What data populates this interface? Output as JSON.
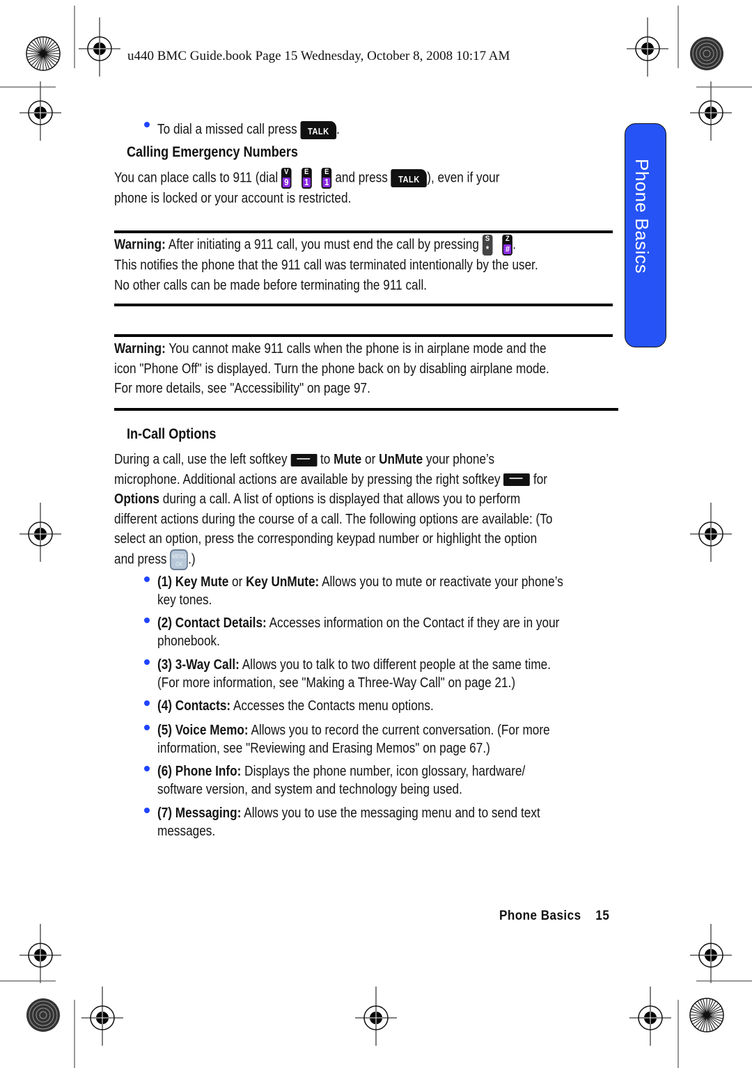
{
  "header": {
    "print_line": "u440 BMC Guide.book  Page 15  Wednesday, October 8, 2008  10:17 AM"
  },
  "side_tab": {
    "label": "Phone Basics",
    "color": "#2653f5"
  },
  "intro_bullet": {
    "text": "To dial a missed call press",
    "key_icon": "talk-key-icon",
    "key_label": "TALK",
    "suffix": "."
  },
  "emergency": {
    "heading": "Calling Emergency Numbers",
    "line1_a": "You can place calls to 911 (dial",
    "keys": [
      {
        "top": "V",
        "bottom": "9"
      },
      {
        "top": "E",
        "bottom": "1"
      },
      {
        "top": "E",
        "bottom": "1"
      }
    ],
    "line1_b": "and press",
    "talk_label": "TALK",
    "line1_c": "), even if your",
    "line2": "phone is locked or your account is restricted."
  },
  "warning1": {
    "label": "Warning:",
    "line1": "After initiating a 911 call, you must end the call by pressing",
    "keys": [
      {
        "top": "S",
        "bottom": "*"
      },
      {
        "top": "Z",
        "bottom": "#"
      }
    ],
    "line1_end": ".",
    "line2": "This notifies the phone that the 911 call was terminated intentionally by the user.",
    "line3": "No other calls can be made before terminating the 911 call."
  },
  "warning2": {
    "label": "Warning:",
    "line1": "You cannot make 911 calls when the phone is in airplane mode and the",
    "line2": "icon \"Phone Off\" is displayed. Turn the phone back on by disabling airplane mode.",
    "line3": "For more details, see \"Accessibility\" on page 97."
  },
  "in_call": {
    "heading": "In-Call Options",
    "p1_a": "During a call, use the left softkey",
    "p1_b": "to",
    "p1_mute": "Mute",
    "p1_or": "or",
    "p1_unmute": "UnMute",
    "p1_c": "your phone’s",
    "p2_a": "microphone. Additional actions are available by pressing the right softkey",
    "p2_b": "for",
    "p3_options": "Options",
    "p3_rest": "during a call. A list of options is displayed that allows you to perform",
    "p4": "different actions during the course of a call. The following options are available: (To",
    "p5": "select an option, press the corresponding keypad number or highlight the option",
    "p6_a": "and press",
    "menu_key_top": "MENU",
    "menu_key_bottom": "OK",
    "p6_b": ".)"
  },
  "options": [
    {
      "bold": "(1) Key Mute",
      "mid": " or ",
      "bold2": "Key UnMute:",
      "text": " Allows you to mute or reactivate your phone’s",
      "line2": "key tones."
    },
    {
      "bold": "(2) Contact Details:",
      "text": " Accesses information on the Contact if they are in your",
      "line2": "phonebook."
    },
    {
      "bold": "(3) 3-Way Call:",
      "text": " Allows you to talk to two different people at the same time.",
      "line2": "(For more information, see \"Making a Three-Way Call\" on page 21.)"
    },
    {
      "bold": "(4) Contacts:",
      "text": " Accesses the Contacts menu options.",
      "line2": ""
    },
    {
      "bold": "(5) Voice Memo:",
      "text": " Allows you to record the current conversation. (For more",
      "line2": "information, see \"Reviewing and Erasing Memos\" on page 67.)"
    },
    {
      "bold": "(6) Phone Info:",
      "text": " Displays the phone number, icon glossary, hardware/",
      "line2": "software version, and system and technology being used."
    },
    {
      "bold": "(7) Messaging:",
      "text": " Allows you to use the messaging menu and to send text",
      "line2": "messages."
    }
  ],
  "footer": {
    "section": "Phone Basics",
    "page": "15"
  },
  "colors": {
    "bullet": "#1f44ff",
    "key_purple": "#8a2be2",
    "tab_blue": "#2653f5"
  }
}
